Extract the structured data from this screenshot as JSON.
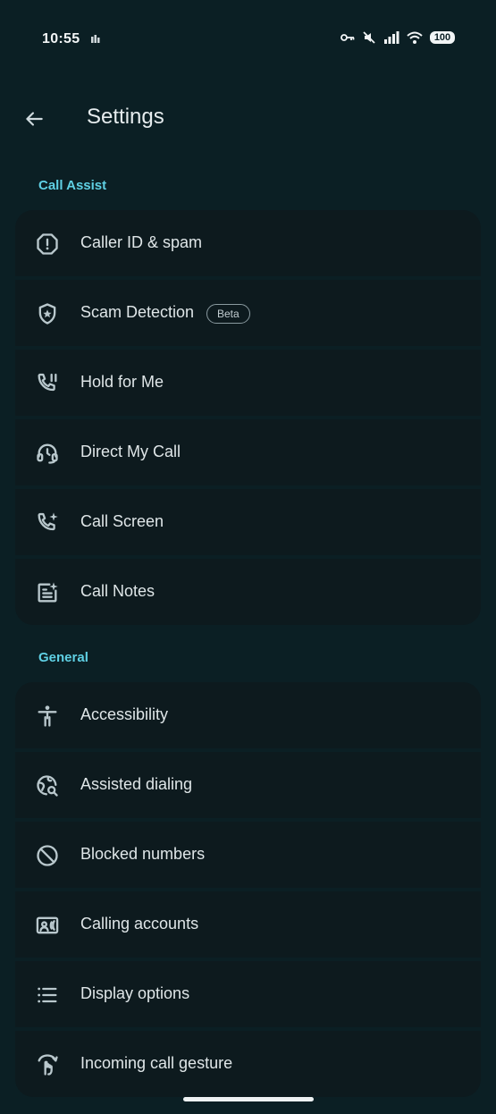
{
  "status": {
    "time": "10:55",
    "battery": "100"
  },
  "header": {
    "title": "Settings"
  },
  "sections": {
    "call_assist": {
      "title": "Call Assist",
      "items": [
        {
          "label": "Caller ID & spam",
          "icon": "alert-octagon-icon"
        },
        {
          "label": "Scam Detection",
          "icon": "shield-star-icon",
          "badge": "Beta"
        },
        {
          "label": "Hold for Me",
          "icon": "phone-pause-icon"
        },
        {
          "label": "Direct My Call",
          "icon": "headset-icon"
        },
        {
          "label": "Call Screen",
          "icon": "phone-sparkle-icon"
        },
        {
          "label": "Call Notes",
          "icon": "notes-sparkle-icon"
        }
      ]
    },
    "general": {
      "title": "General",
      "items": [
        {
          "label": "Accessibility",
          "icon": "accessibility-icon"
        },
        {
          "label": "Assisted dialing",
          "icon": "globe-search-icon"
        },
        {
          "label": "Blocked numbers",
          "icon": "block-icon"
        },
        {
          "label": "Calling accounts",
          "icon": "contact-card-icon"
        },
        {
          "label": "Display options",
          "icon": "list-icon"
        },
        {
          "label": "Incoming call gesture",
          "icon": "gesture-icon"
        }
      ]
    }
  },
  "colors": {
    "background": "#0b1f24",
    "row": "#0d1a1e",
    "accent": "#5fd0e4"
  }
}
